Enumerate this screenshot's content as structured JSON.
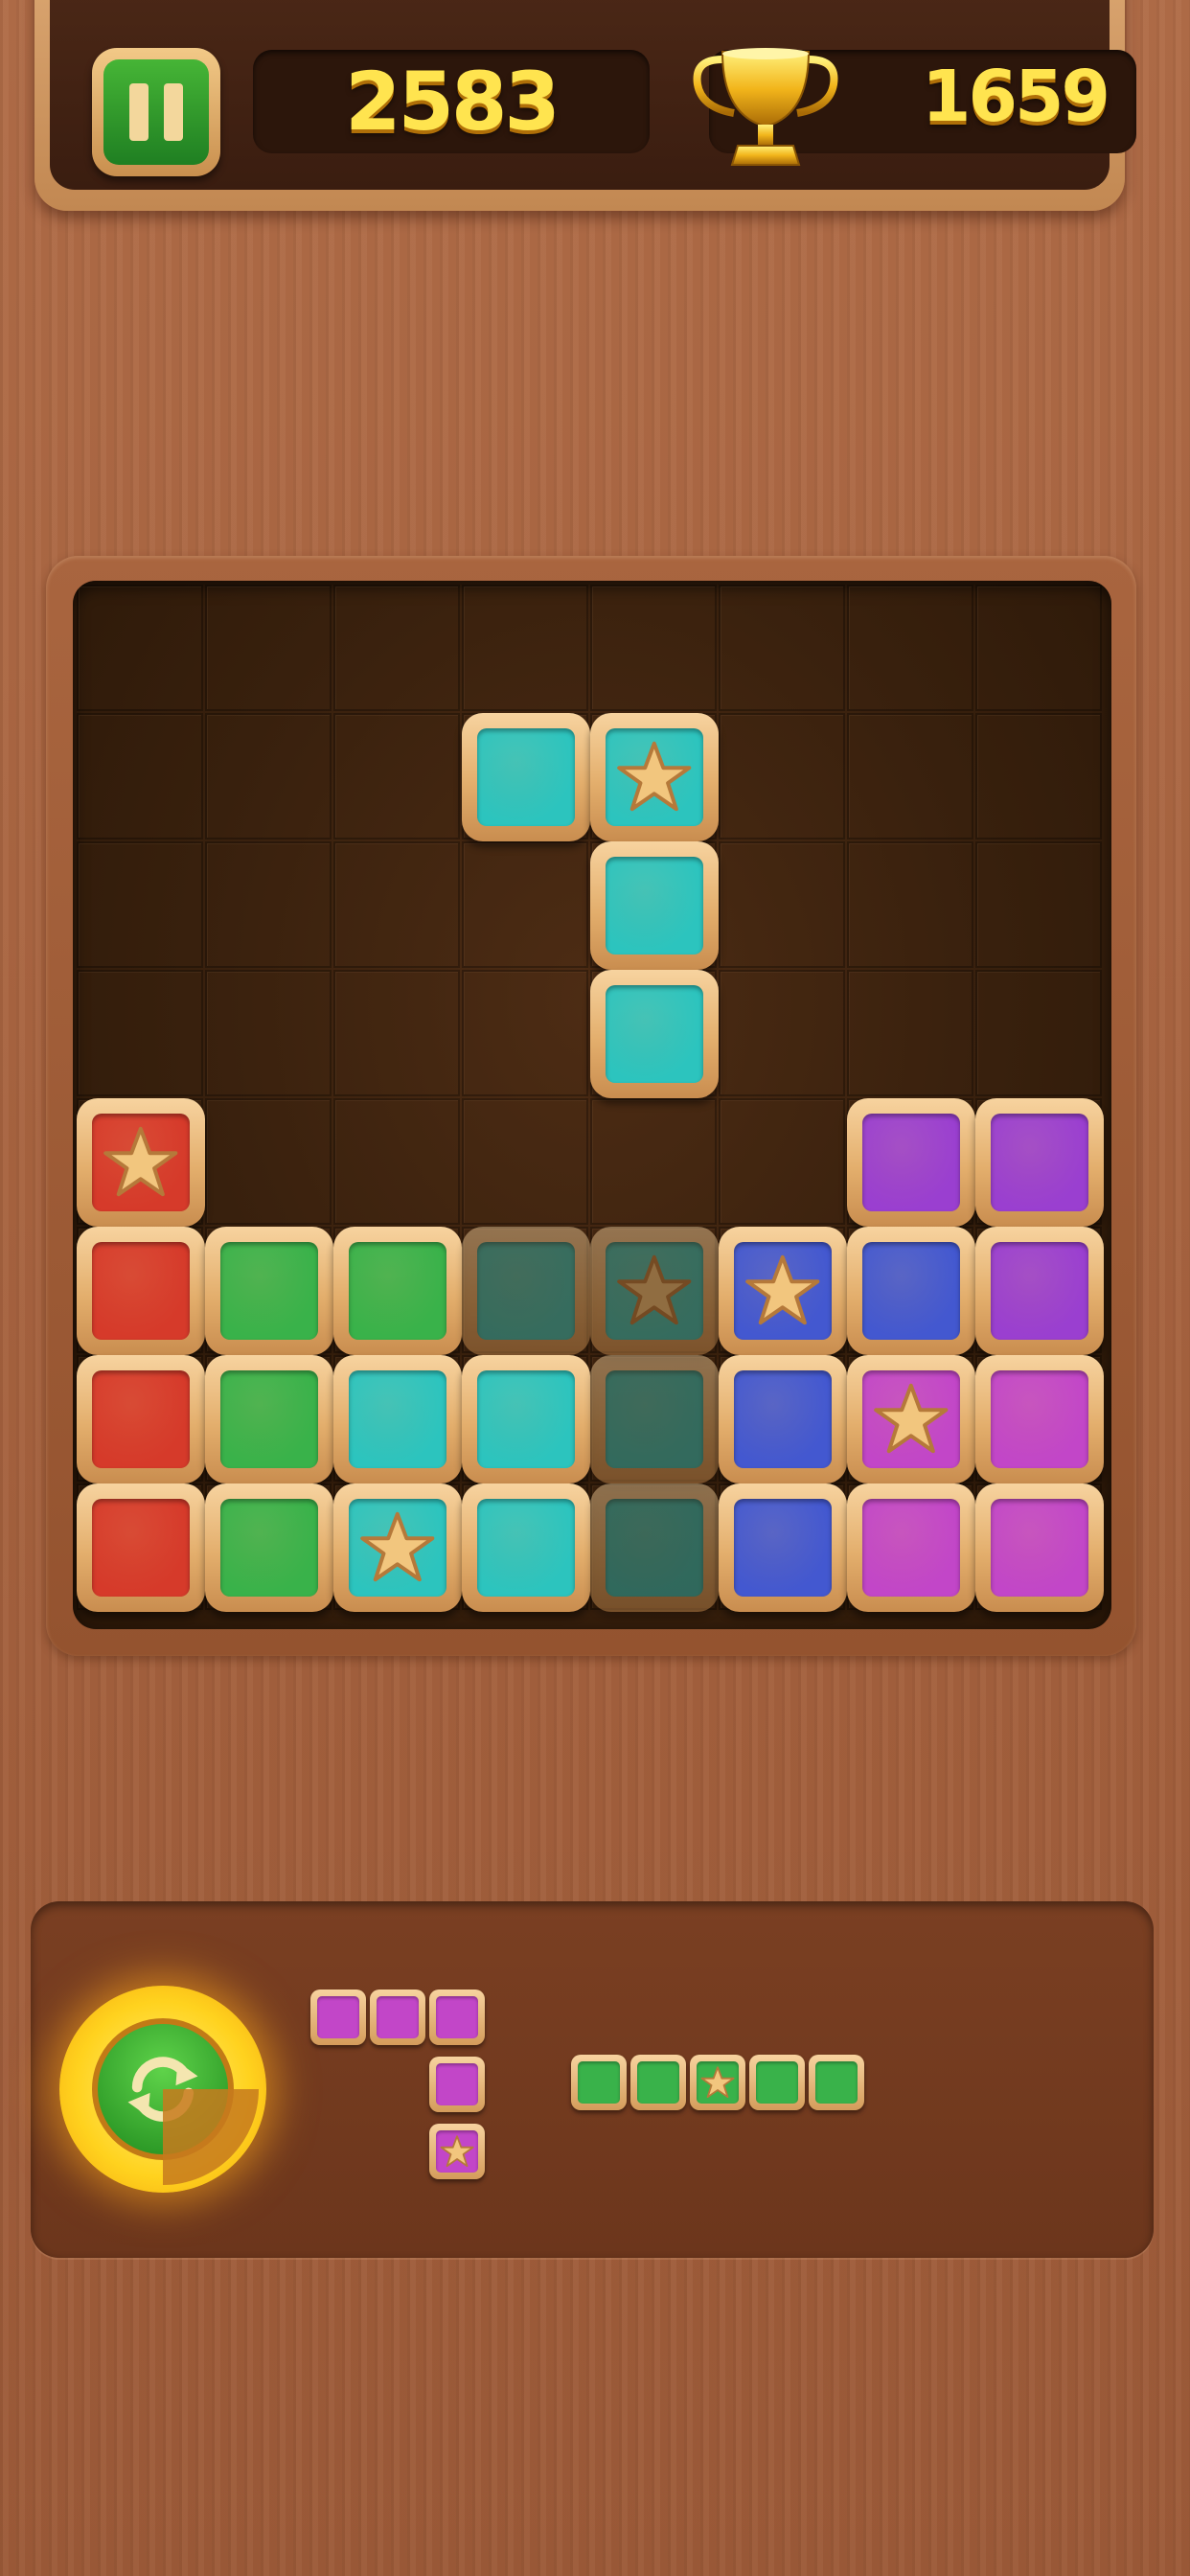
{
  "hud": {
    "score": "2583",
    "best_score": "1659",
    "pause_icon": "pause-icon",
    "trophy_icon": "trophy-icon"
  },
  "colors": {
    "red": "#d63a2a",
    "green": "#39b24a",
    "teal": "#2cc4be",
    "blue": "#4358d0",
    "purple": "#9a3fd0",
    "magenta": "#c246c8",
    "wood_frame": "#e3ae6c"
  },
  "board": {
    "rows": 8,
    "cols": 8,
    "blocks": [
      {
        "r": 1,
        "c": 3,
        "color": "teal"
      },
      {
        "r": 1,
        "c": 4,
        "color": "teal",
        "star": true
      },
      {
        "r": 2,
        "c": 4,
        "color": "teal"
      },
      {
        "r": 3,
        "c": 4,
        "color": "teal"
      },
      {
        "r": 4,
        "c": 0,
        "color": "red",
        "star": true
      },
      {
        "r": 4,
        "c": 6,
        "color": "purple"
      },
      {
        "r": 4,
        "c": 7,
        "color": "purple"
      },
      {
        "r": 5,
        "c": 0,
        "color": "red"
      },
      {
        "r": 5,
        "c": 1,
        "color": "green"
      },
      {
        "r": 5,
        "c": 2,
        "color": "green"
      },
      {
        "r": 5,
        "c": 3,
        "color": "teal",
        "ghost": true
      },
      {
        "r": 5,
        "c": 4,
        "color": "teal",
        "ghost": true,
        "star": true
      },
      {
        "r": 5,
        "c": 5,
        "color": "blue",
        "star": true
      },
      {
        "r": 5,
        "c": 6,
        "color": "blue"
      },
      {
        "r": 5,
        "c": 7,
        "color": "purple"
      },
      {
        "r": 6,
        "c": 0,
        "color": "red"
      },
      {
        "r": 6,
        "c": 1,
        "color": "green"
      },
      {
        "r": 6,
        "c": 2,
        "color": "teal"
      },
      {
        "r": 6,
        "c": 3,
        "color": "teal"
      },
      {
        "r": 6,
        "c": 4,
        "color": "teal",
        "ghost": true
      },
      {
        "r": 6,
        "c": 5,
        "color": "blue"
      },
      {
        "r": 6,
        "c": 6,
        "color": "magenta",
        "star": true
      },
      {
        "r": 6,
        "c": 7,
        "color": "magenta"
      },
      {
        "r": 7,
        "c": 0,
        "color": "red"
      },
      {
        "r": 7,
        "c": 1,
        "color": "green"
      },
      {
        "r": 7,
        "c": 2,
        "color": "teal",
        "star": true
      },
      {
        "r": 7,
        "c": 3,
        "color": "teal"
      },
      {
        "r": 7,
        "c": 4,
        "color": "teal",
        "ghost": true
      },
      {
        "r": 7,
        "c": 5,
        "color": "blue"
      },
      {
        "r": 7,
        "c": 6,
        "color": "magenta"
      },
      {
        "r": 7,
        "c": 7,
        "color": "magenta"
      }
    ]
  },
  "tray": {
    "rotate_icon": "rotate-icon",
    "pieces": [
      {
        "name": "piece-magenta-corner",
        "color": "magenta",
        "cells": [
          [
            0,
            0
          ],
          [
            0,
            1
          ],
          [
            0,
            2
          ],
          [
            1,
            2
          ],
          [
            2,
            2,
            "star"
          ]
        ]
      },
      {
        "name": "piece-green-line",
        "color": "green",
        "cells": [
          [
            0,
            0
          ],
          [
            0,
            1
          ],
          [
            0,
            2,
            "star"
          ],
          [
            0,
            3
          ],
          [
            0,
            4
          ]
        ]
      }
    ]
  }
}
